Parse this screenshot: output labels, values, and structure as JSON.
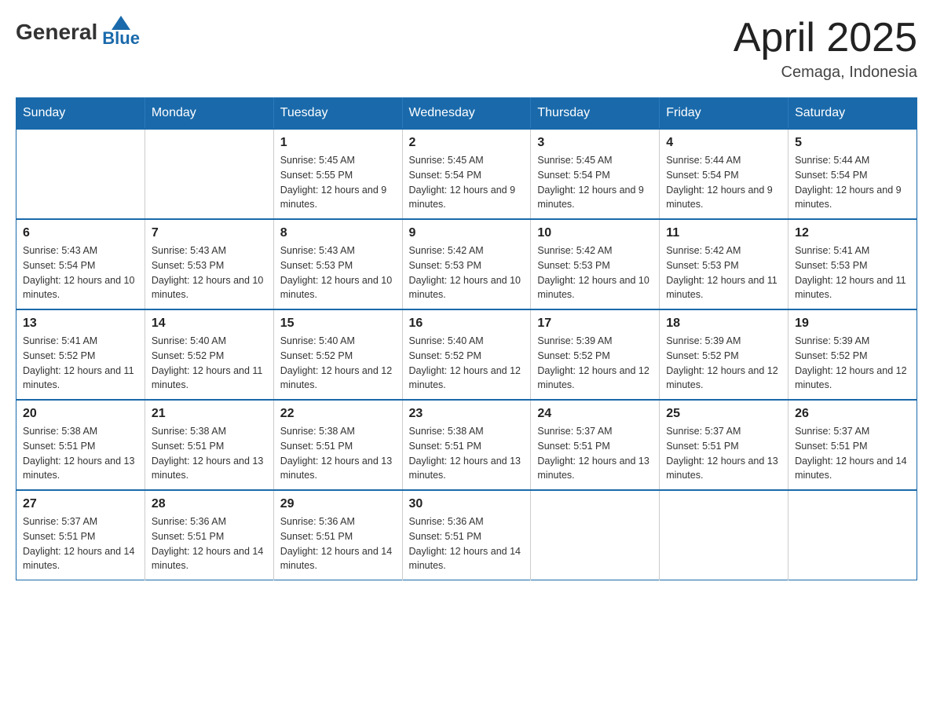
{
  "header": {
    "logo_general": "General",
    "logo_blue": "Blue",
    "month_year": "April 2025",
    "location": "Cemaga, Indonesia"
  },
  "weekdays": [
    "Sunday",
    "Monday",
    "Tuesday",
    "Wednesday",
    "Thursday",
    "Friday",
    "Saturday"
  ],
  "weeks": [
    [
      {
        "day": "",
        "sunrise": "",
        "sunset": "",
        "daylight": ""
      },
      {
        "day": "",
        "sunrise": "",
        "sunset": "",
        "daylight": ""
      },
      {
        "day": "1",
        "sunrise": "Sunrise: 5:45 AM",
        "sunset": "Sunset: 5:55 PM",
        "daylight": "Daylight: 12 hours and 9 minutes."
      },
      {
        "day": "2",
        "sunrise": "Sunrise: 5:45 AM",
        "sunset": "Sunset: 5:54 PM",
        "daylight": "Daylight: 12 hours and 9 minutes."
      },
      {
        "day": "3",
        "sunrise": "Sunrise: 5:45 AM",
        "sunset": "Sunset: 5:54 PM",
        "daylight": "Daylight: 12 hours and 9 minutes."
      },
      {
        "day": "4",
        "sunrise": "Sunrise: 5:44 AM",
        "sunset": "Sunset: 5:54 PM",
        "daylight": "Daylight: 12 hours and 9 minutes."
      },
      {
        "day": "5",
        "sunrise": "Sunrise: 5:44 AM",
        "sunset": "Sunset: 5:54 PM",
        "daylight": "Daylight: 12 hours and 9 minutes."
      }
    ],
    [
      {
        "day": "6",
        "sunrise": "Sunrise: 5:43 AM",
        "sunset": "Sunset: 5:54 PM",
        "daylight": "Daylight: 12 hours and 10 minutes."
      },
      {
        "day": "7",
        "sunrise": "Sunrise: 5:43 AM",
        "sunset": "Sunset: 5:53 PM",
        "daylight": "Daylight: 12 hours and 10 minutes."
      },
      {
        "day": "8",
        "sunrise": "Sunrise: 5:43 AM",
        "sunset": "Sunset: 5:53 PM",
        "daylight": "Daylight: 12 hours and 10 minutes."
      },
      {
        "day": "9",
        "sunrise": "Sunrise: 5:42 AM",
        "sunset": "Sunset: 5:53 PM",
        "daylight": "Daylight: 12 hours and 10 minutes."
      },
      {
        "day": "10",
        "sunrise": "Sunrise: 5:42 AM",
        "sunset": "Sunset: 5:53 PM",
        "daylight": "Daylight: 12 hours and 10 minutes."
      },
      {
        "day": "11",
        "sunrise": "Sunrise: 5:42 AM",
        "sunset": "Sunset: 5:53 PM",
        "daylight": "Daylight: 12 hours and 11 minutes."
      },
      {
        "day": "12",
        "sunrise": "Sunrise: 5:41 AM",
        "sunset": "Sunset: 5:53 PM",
        "daylight": "Daylight: 12 hours and 11 minutes."
      }
    ],
    [
      {
        "day": "13",
        "sunrise": "Sunrise: 5:41 AM",
        "sunset": "Sunset: 5:52 PM",
        "daylight": "Daylight: 12 hours and 11 minutes."
      },
      {
        "day": "14",
        "sunrise": "Sunrise: 5:40 AM",
        "sunset": "Sunset: 5:52 PM",
        "daylight": "Daylight: 12 hours and 11 minutes."
      },
      {
        "day": "15",
        "sunrise": "Sunrise: 5:40 AM",
        "sunset": "Sunset: 5:52 PM",
        "daylight": "Daylight: 12 hours and 12 minutes."
      },
      {
        "day": "16",
        "sunrise": "Sunrise: 5:40 AM",
        "sunset": "Sunset: 5:52 PM",
        "daylight": "Daylight: 12 hours and 12 minutes."
      },
      {
        "day": "17",
        "sunrise": "Sunrise: 5:39 AM",
        "sunset": "Sunset: 5:52 PM",
        "daylight": "Daylight: 12 hours and 12 minutes."
      },
      {
        "day": "18",
        "sunrise": "Sunrise: 5:39 AM",
        "sunset": "Sunset: 5:52 PM",
        "daylight": "Daylight: 12 hours and 12 minutes."
      },
      {
        "day": "19",
        "sunrise": "Sunrise: 5:39 AM",
        "sunset": "Sunset: 5:52 PM",
        "daylight": "Daylight: 12 hours and 12 minutes."
      }
    ],
    [
      {
        "day": "20",
        "sunrise": "Sunrise: 5:38 AM",
        "sunset": "Sunset: 5:51 PM",
        "daylight": "Daylight: 12 hours and 13 minutes."
      },
      {
        "day": "21",
        "sunrise": "Sunrise: 5:38 AM",
        "sunset": "Sunset: 5:51 PM",
        "daylight": "Daylight: 12 hours and 13 minutes."
      },
      {
        "day": "22",
        "sunrise": "Sunrise: 5:38 AM",
        "sunset": "Sunset: 5:51 PM",
        "daylight": "Daylight: 12 hours and 13 minutes."
      },
      {
        "day": "23",
        "sunrise": "Sunrise: 5:38 AM",
        "sunset": "Sunset: 5:51 PM",
        "daylight": "Daylight: 12 hours and 13 minutes."
      },
      {
        "day": "24",
        "sunrise": "Sunrise: 5:37 AM",
        "sunset": "Sunset: 5:51 PM",
        "daylight": "Daylight: 12 hours and 13 minutes."
      },
      {
        "day": "25",
        "sunrise": "Sunrise: 5:37 AM",
        "sunset": "Sunset: 5:51 PM",
        "daylight": "Daylight: 12 hours and 13 minutes."
      },
      {
        "day": "26",
        "sunrise": "Sunrise: 5:37 AM",
        "sunset": "Sunset: 5:51 PM",
        "daylight": "Daylight: 12 hours and 14 minutes."
      }
    ],
    [
      {
        "day": "27",
        "sunrise": "Sunrise: 5:37 AM",
        "sunset": "Sunset: 5:51 PM",
        "daylight": "Daylight: 12 hours and 14 minutes."
      },
      {
        "day": "28",
        "sunrise": "Sunrise: 5:36 AM",
        "sunset": "Sunset: 5:51 PM",
        "daylight": "Daylight: 12 hours and 14 minutes."
      },
      {
        "day": "29",
        "sunrise": "Sunrise: 5:36 AM",
        "sunset": "Sunset: 5:51 PM",
        "daylight": "Daylight: 12 hours and 14 minutes."
      },
      {
        "day": "30",
        "sunrise": "Sunrise: 5:36 AM",
        "sunset": "Sunset: 5:51 PM",
        "daylight": "Daylight: 12 hours and 14 minutes."
      },
      {
        "day": "",
        "sunrise": "",
        "sunset": "",
        "daylight": ""
      },
      {
        "day": "",
        "sunrise": "",
        "sunset": "",
        "daylight": ""
      },
      {
        "day": "",
        "sunrise": "",
        "sunset": "",
        "daylight": ""
      }
    ]
  ]
}
